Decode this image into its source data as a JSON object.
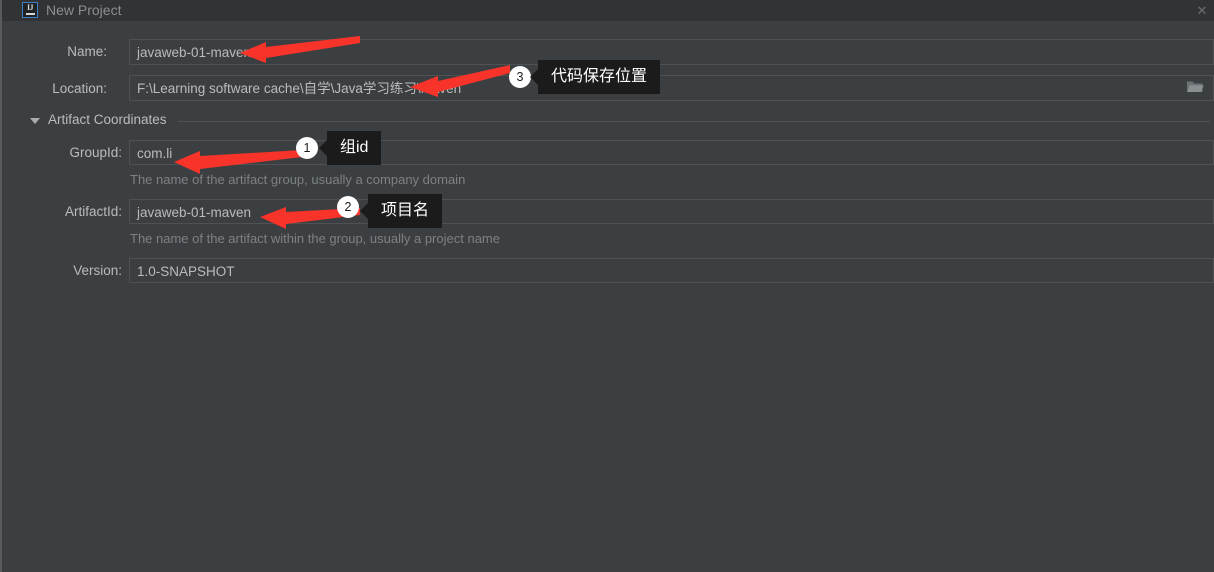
{
  "window": {
    "title": "New Project",
    "logo_icon": "intellij-idea-icon",
    "logo_text": "IJ",
    "close_icon": "close-icon",
    "close_glyph": "✕"
  },
  "form": {
    "name": {
      "label": "Name:",
      "value": "javaweb-01-maven"
    },
    "location": {
      "label": "Location:",
      "value": "F:\\Learning software cache\\自学\\Java学习练习\\Maven",
      "browse_icon": "folder-icon"
    },
    "section": {
      "title": "Artifact Coordinates",
      "expand_icon": "chevron-down-icon"
    },
    "group_id": {
      "label": "GroupId:",
      "value": "com.li",
      "hint": "The name of the artifact group, usually a company domain"
    },
    "artifact_id": {
      "label": "ArtifactId:",
      "value": "javaweb-01-maven",
      "hint": "The name of the artifact within the group, usually a project name"
    },
    "version": {
      "label": "Version:",
      "value": "1.0-SNAPSHOT"
    }
  },
  "annotations": {
    "accent_color": "#f8332a",
    "items": [
      {
        "badge": "1",
        "text": "组id"
      },
      {
        "badge": "2",
        "text": "项目名"
      },
      {
        "badge": "3",
        "text": "代码保存位置"
      }
    ]
  }
}
